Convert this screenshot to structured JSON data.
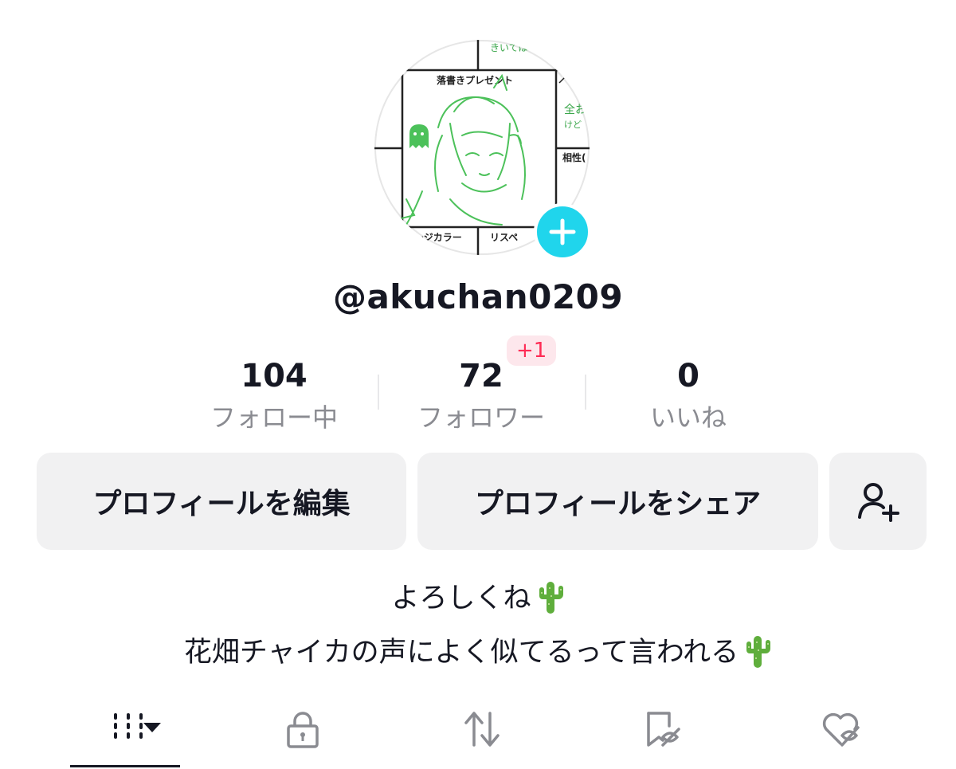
{
  "profile": {
    "username": "@akuchan0209",
    "avatar_texts": {
      "title": "落書きプレゼント",
      "top": "きいては",
      "right_top": "全お",
      "right_mid": "けど",
      "affinity": "相性(",
      "bottom_left": "メージカラー",
      "bottom_right": "リスペ"
    }
  },
  "stats": {
    "following": {
      "value": "104",
      "label": "フォロー中"
    },
    "followers": {
      "value": "72",
      "label": "フォロワー",
      "badge": "+1"
    },
    "likes": {
      "value": "0",
      "label": "いいね"
    }
  },
  "buttons": {
    "edit_profile": "プロフィールを編集",
    "share_profile": "プロフィールをシェア"
  },
  "bio": {
    "line1": "よろしくね",
    "line2": "花畑チャイカの声によく似てるって言われる"
  },
  "tabs": [
    "videos-grid",
    "private",
    "reposts",
    "favorites-hidden",
    "liked-hidden"
  ],
  "colors": {
    "accent_cyan": "#20d5ec",
    "badge_pink": "#fe2c55",
    "sketch_green": "#4cc15a"
  }
}
